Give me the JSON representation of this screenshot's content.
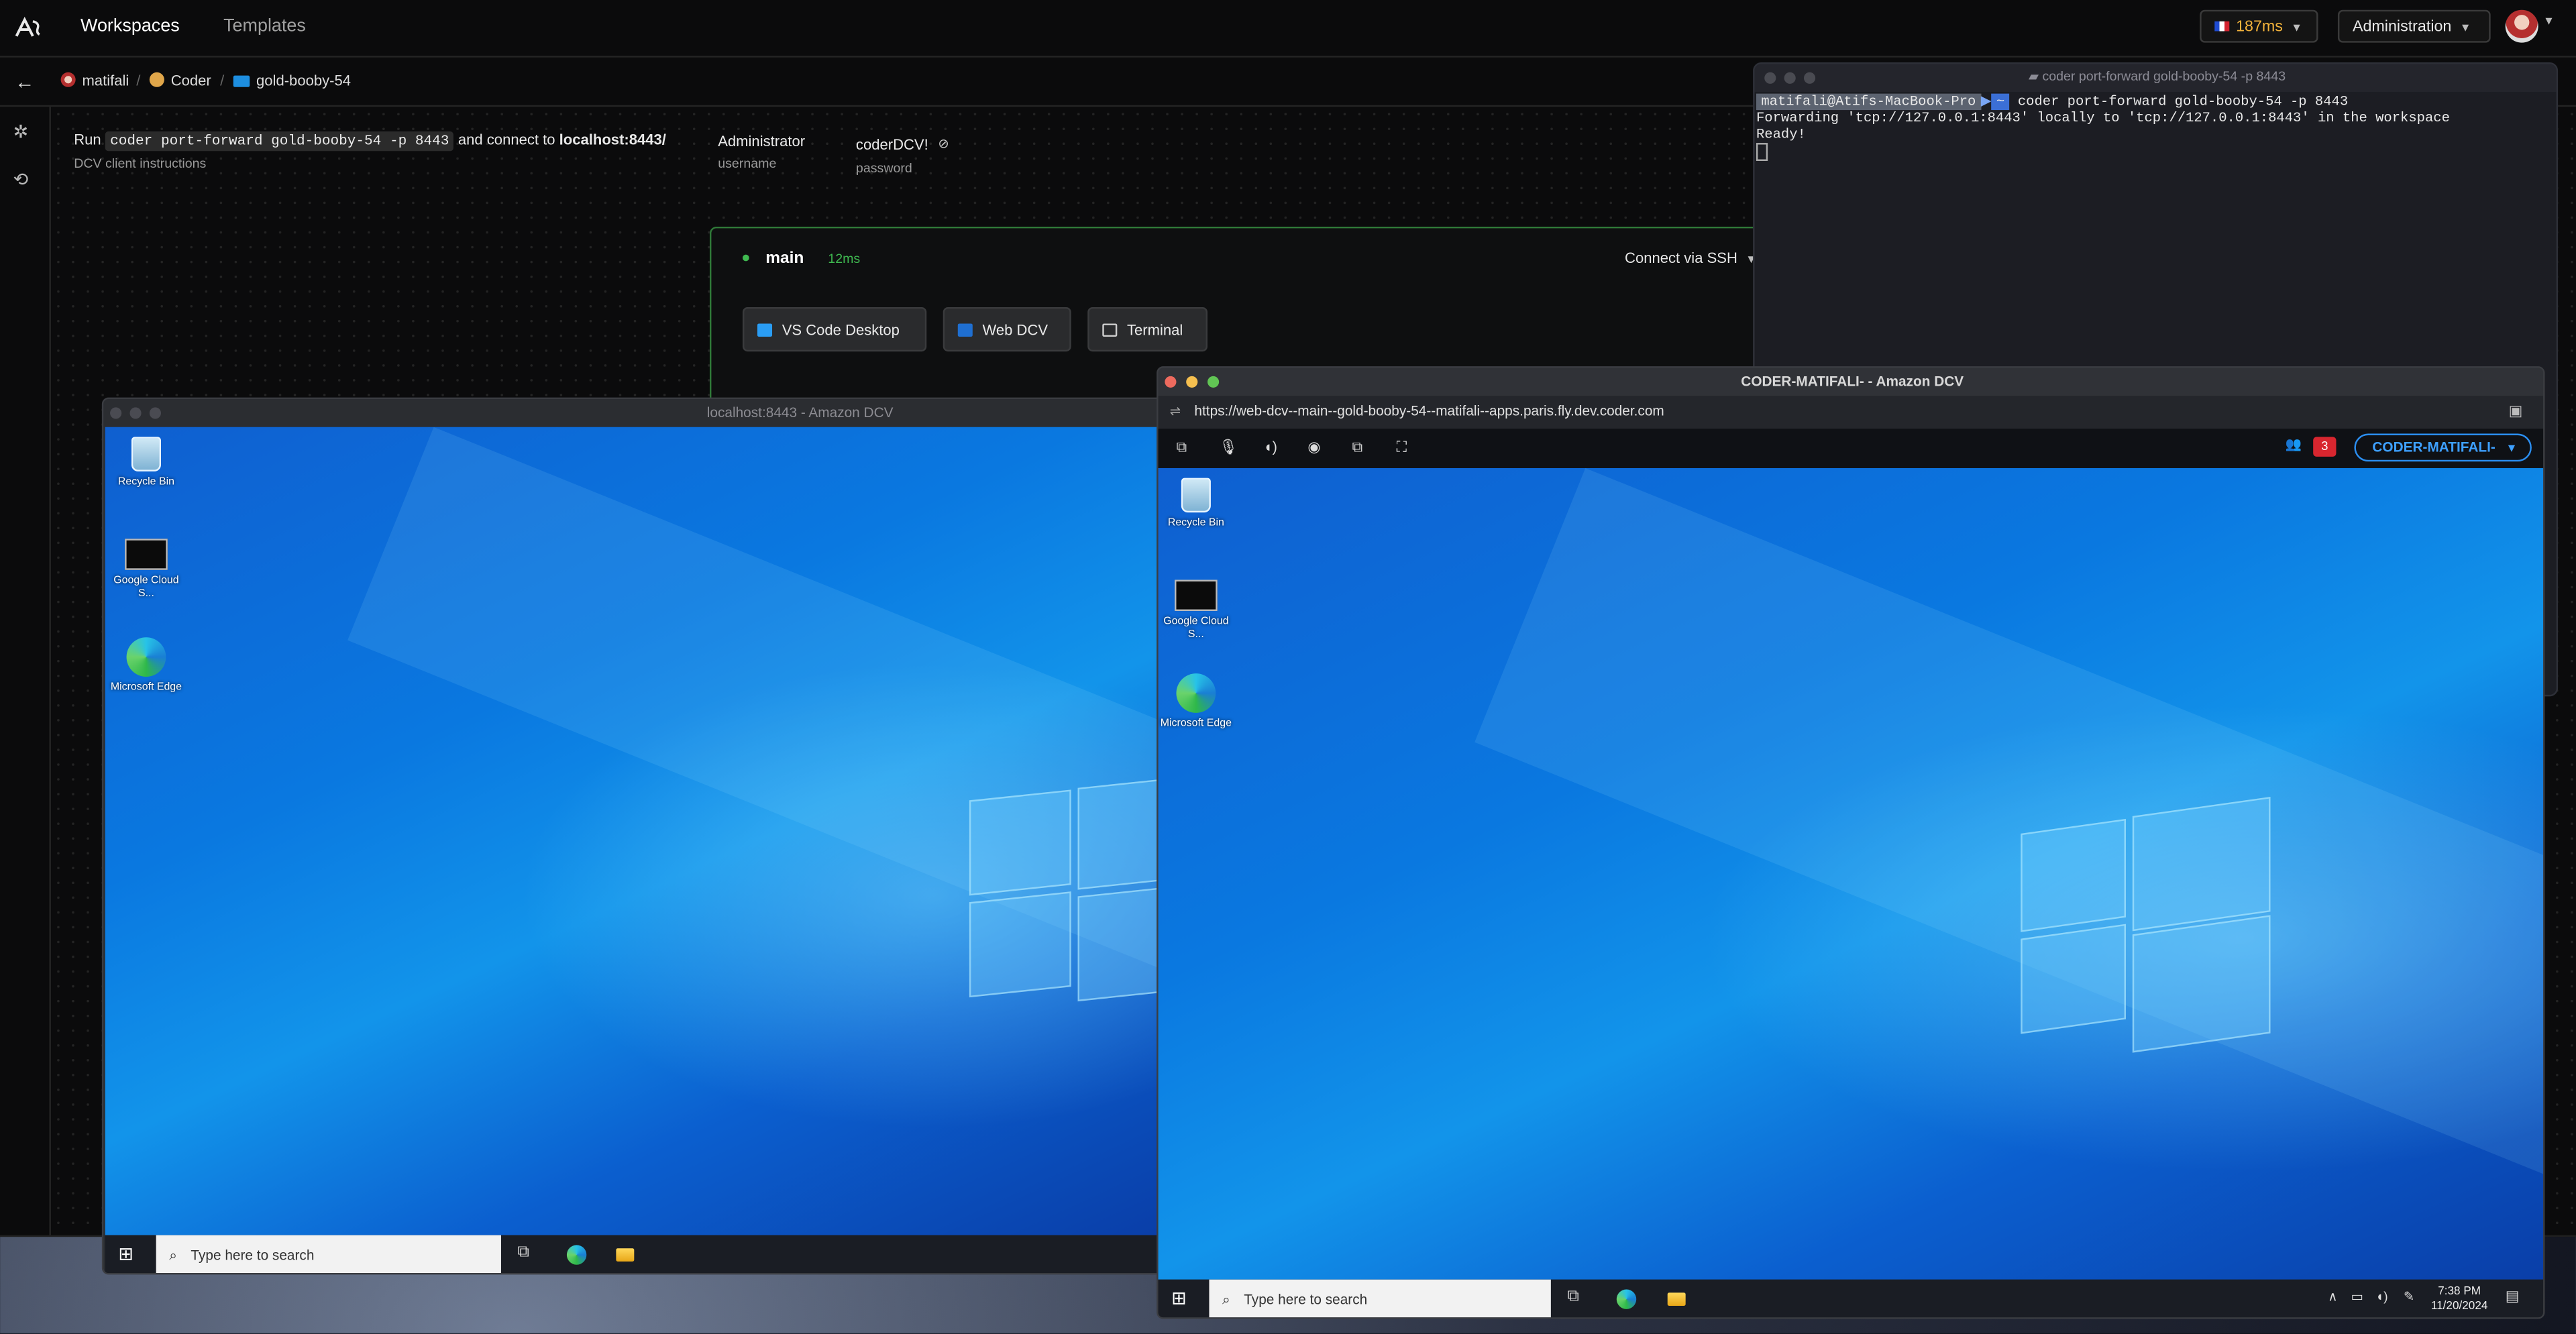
{
  "nav": {
    "tabs": [
      "Workspaces",
      "Templates"
    ],
    "latency": "187ms",
    "admin_label": "Administration"
  },
  "breadcrumb": {
    "owner": "matifali",
    "template": "Coder",
    "workspace": "gold-booby-54"
  },
  "dcv": {
    "run_prefix": "Run",
    "command": "coder port-forward gold-booby-54 -p 8443",
    "connect_text": "and connect to",
    "address": "localhost:8443/",
    "instructions_label": "DCV client instructions",
    "username": "Administrator",
    "username_label": "username",
    "password": "coderDCV!",
    "password_label": "password"
  },
  "agent": {
    "name": "main",
    "latency": "12ms",
    "connect_ssh": "Connect via SSH",
    "apps": [
      "VS Code Desktop",
      "Web DCV",
      "Terminal"
    ]
  },
  "terminal": {
    "title": "coder port-forward gold-booby-54 -p 8443",
    "prompt": "matifali@Atifs-MacBook-Pro",
    "prompt_dir": "~",
    "command": "coder port-forward gold-booby-54 -p 8443",
    "line1": "Forwarding 'tcp://127.0.0.1:8443' locally to 'tcp://127.0.0.1:8443' in the workspace",
    "line2": "Ready!"
  },
  "dcv_client_window": {
    "title": "localhost:8443 - Amazon DCV"
  },
  "web_dcv_window": {
    "title": "CODER-MATIFALI- - Amazon DCV",
    "url": "https://web-dcv--main--gold-booby-54--matifali--apps.paris.fly.dev.coder.com",
    "notification_count": "3",
    "session_name": "CODER-MATIFALI-"
  },
  "desktop": {
    "icons": [
      "Recycle Bin",
      "Google Cloud S...",
      "Microsoft Edge"
    ],
    "search_placeholder": "Type here to search",
    "clock_time": "7:38 PM",
    "clock_date": "11/20/2024"
  },
  "colors": {
    "accent_green": "#3fb950",
    "latency_amber": "#f3b33b",
    "dcv_blue": "#2b8ef0",
    "badge_red": "#d8262f"
  }
}
